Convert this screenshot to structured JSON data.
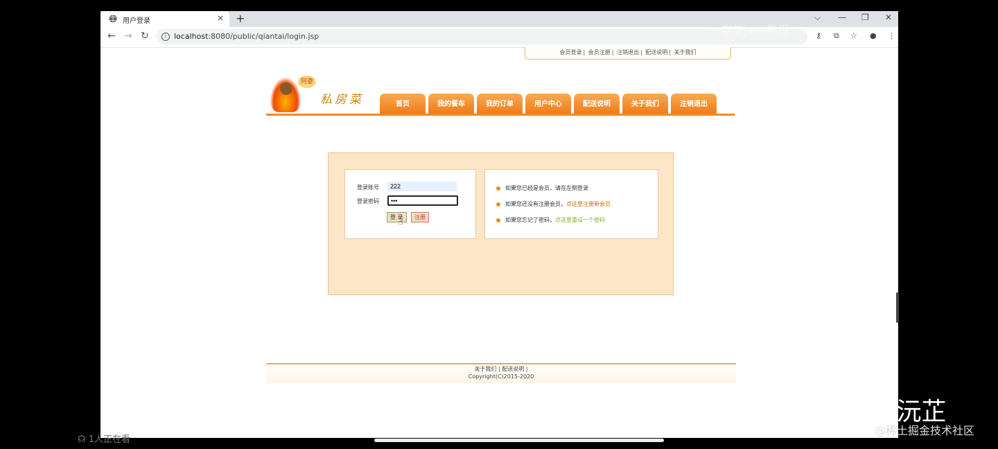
{
  "browser": {
    "tab_title": "用户登录",
    "tab_close": "×",
    "new_tab": "+",
    "url_host": "localhost",
    "url_rest": ":8080/public/qiantai/login.jsp",
    "window_controls": [
      "⌵",
      "—",
      "❐",
      "✕"
    ]
  },
  "top_links": [
    "会员登录",
    "会员注册",
    "注销退出",
    "配送说明",
    "关于我们"
  ],
  "logo": {
    "badge": "阿婆",
    "name": "私房菜"
  },
  "main_nav": [
    "首页",
    "我的餐车",
    "我的订单",
    "用户中心",
    "配送说明",
    "关于我们",
    "注销退出"
  ],
  "login": {
    "account_label": "登录账号",
    "account_value": "222",
    "password_label": "登录密码",
    "password_value": "•••",
    "login_button": "登 录",
    "register_button": "注册"
  },
  "tips": [
    {
      "text": "如果您已经是会员，请在左侧登录",
      "link": ""
    },
    {
      "text": "如果您还没有注册会员，",
      "link": "点这里注册新会员"
    },
    {
      "text": "如果您忘记了密码，",
      "link": "点这里重设一个密码"
    }
  ],
  "footer": {
    "links": "关于我们 |  配送说明 |",
    "copyright": "Copyright(C)2015-2020"
  },
  "overlays": {
    "zhihu": "知乎 @小沅芷",
    "juejin": "@稀土掘金技术社区",
    "top_watermark": "一学堂java教程",
    "viewers": "1人正在看"
  }
}
